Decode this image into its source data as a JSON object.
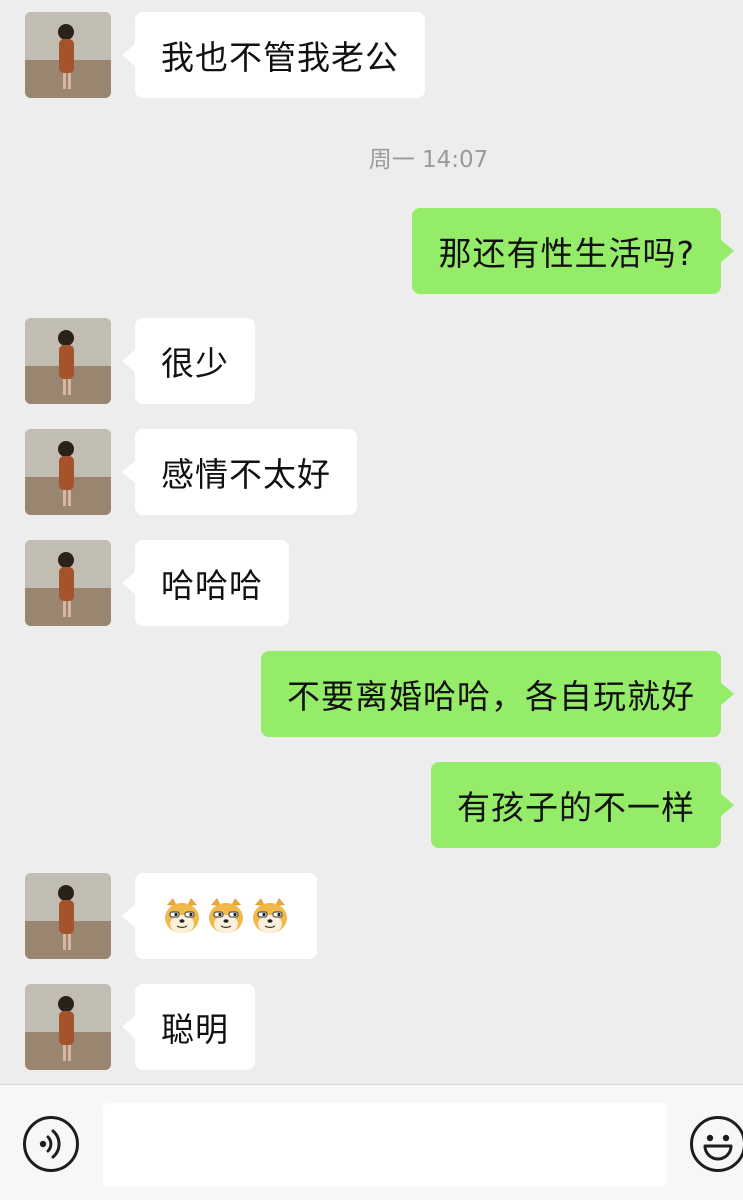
{
  "timestamp": "周一 14:07",
  "messages": [
    {
      "side": "left",
      "text": "我也不管我老公"
    },
    {
      "side": "right",
      "text": "那还有性生活吗?"
    },
    {
      "side": "left",
      "text": "很少"
    },
    {
      "side": "left",
      "text": "感情不太好"
    },
    {
      "side": "left",
      "text": "哈哈哈"
    },
    {
      "side": "right",
      "text": "不要离婚哈哈，各自玩就好"
    },
    {
      "side": "right",
      "text": "有孩子的不一样"
    },
    {
      "side": "left",
      "emoji": [
        "doge-emoji",
        "doge-emoji",
        "doge-emoji"
      ]
    },
    {
      "side": "left",
      "text": "聪明"
    }
  ],
  "input": {
    "placeholder": "",
    "value": ""
  },
  "icons": {
    "voice": "voice-icon",
    "emoji": "smiley-face-icon",
    "avatar": "avatar-photo"
  },
  "colors": {
    "background": "#ededed",
    "sent_bubble": "#95ec69",
    "received_bubble": "#ffffff",
    "timestamp_text": "#9a9a9a"
  }
}
